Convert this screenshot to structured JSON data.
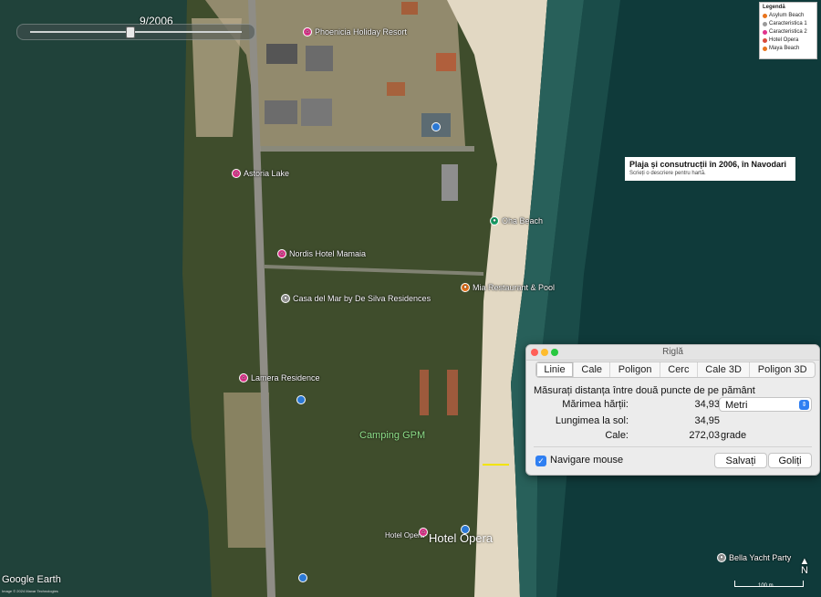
{
  "time_slider": {
    "date_label": "9/2006",
    "position": 0.47
  },
  "legend": {
    "title": "Legendă",
    "items": [
      {
        "label": "Asylum Beach",
        "color": "#e8731c"
      },
      {
        "label": "Caracteristica 1",
        "color": "#9a9a9a"
      },
      {
        "label": "Caracteristica 2",
        "color": "#e0338c"
      },
      {
        "label": "Hotel Opera",
        "color": "#d94a3a"
      },
      {
        "label": "Maya Beach",
        "color": "#e8731c"
      }
    ]
  },
  "map_title": {
    "title": "Plaja și consutrucții în 2006, în Navodari",
    "subtitle": "Scrieți o descriere pentru hartă."
  },
  "placemarks": {
    "phoenicia": "Phoenicia Holiday Resort",
    "astoria": "Astoria Lake",
    "oha": "Oha Beach",
    "nordis": "Nordis Hotel Mamaia",
    "mia": "Mia Restaurant & Pool",
    "casa": "Casa del Mar by De Silva Residences",
    "lamera": "Lamera Residence",
    "camping": "Camping GPM",
    "hotel_small": "Hotel Opera",
    "hotel_big": "Hotel Opera",
    "bella": "Bella Yacht Party"
  },
  "brand": {
    "name": "Google Earth",
    "copyright": "Image © 2024 Maxar Technologies"
  },
  "scale": {
    "label": "100 m"
  },
  "north": {
    "label": "N"
  },
  "ruler": {
    "title": "Riglă",
    "tabs": [
      "Linie",
      "Cale",
      "Poligon",
      "Cerc",
      "Cale 3D",
      "Poligon 3D"
    ],
    "active_tab": "Linie",
    "description": "Măsurați distanța între două puncte de pe pământ",
    "map_length_label": "Mărimea hărții:",
    "map_length_value": "34,93",
    "unit_selected": "Metri",
    "ground_length_label": "Lungimea la sol:",
    "ground_length_value": "34,95",
    "heading_label": "Cale:",
    "heading_value": "272,03",
    "heading_unit": "grade",
    "mouse_nav_label": "Navigare mouse",
    "save_label": "Salvați",
    "clear_label": "Goliți"
  }
}
